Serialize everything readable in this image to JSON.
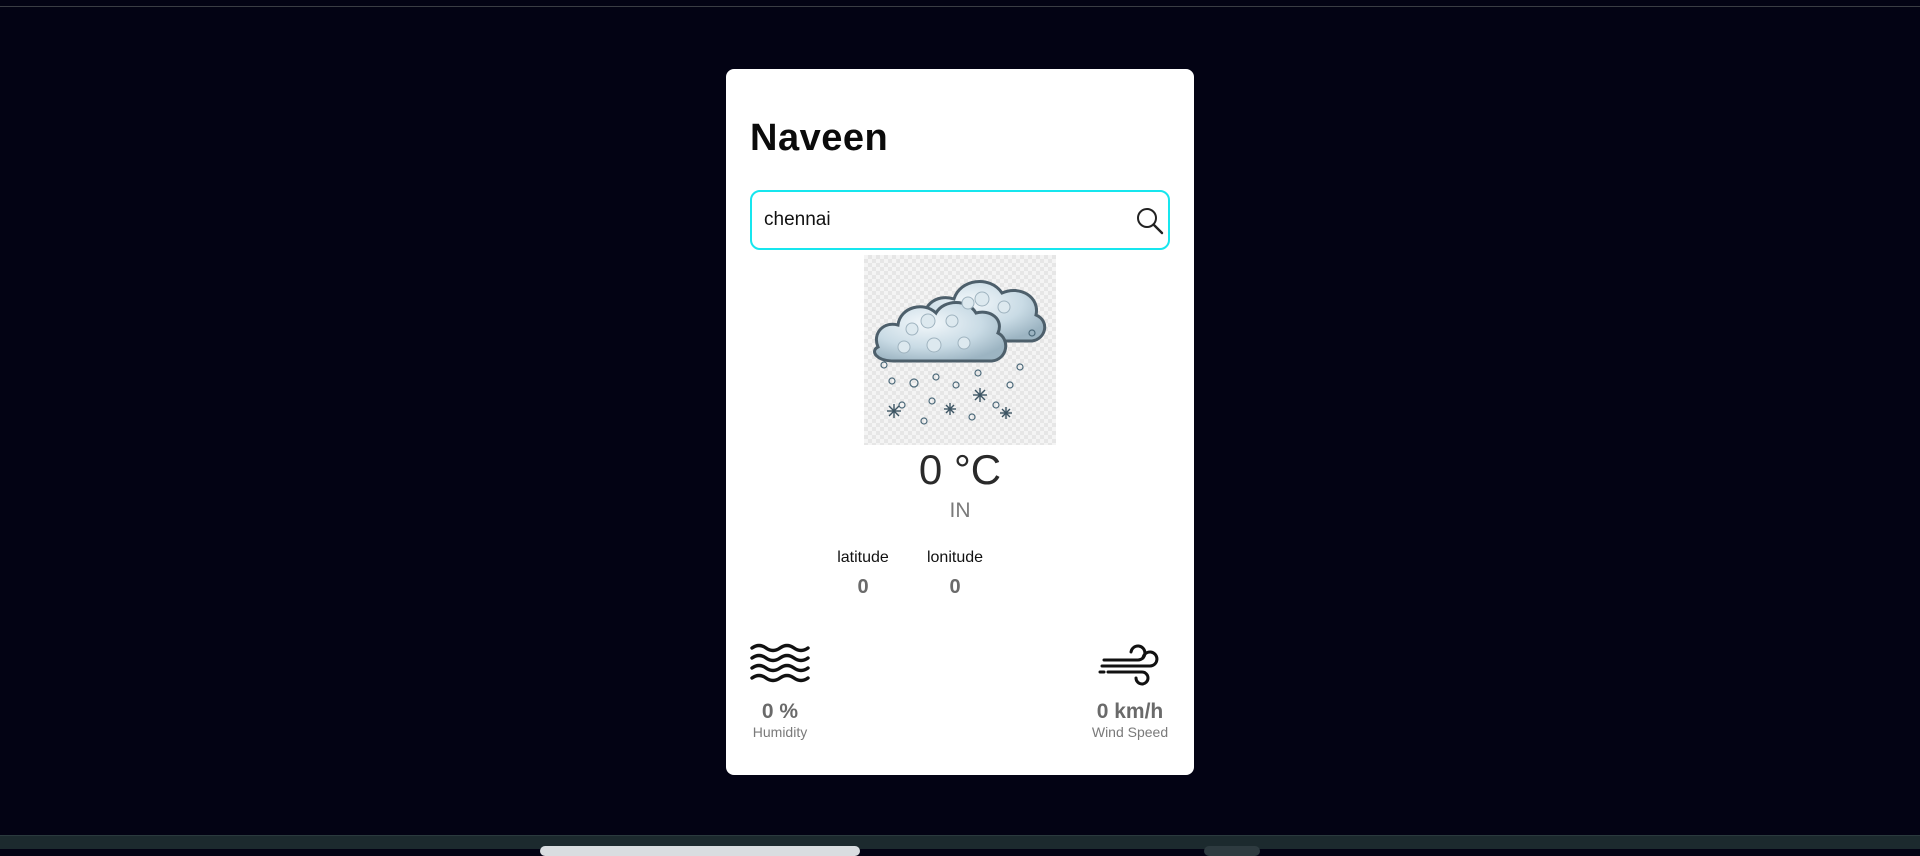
{
  "app": {
    "title": "Naveen"
  },
  "search": {
    "value": "chennai",
    "icon": "search-icon"
  },
  "weather": {
    "icon": "snow-cloud-icon",
    "temperature": "0 °C",
    "country": "IN"
  },
  "coordinates": {
    "latitude_label": "latitude",
    "latitude_value": "0",
    "longitude_label": "lonitude",
    "longitude_value": "0"
  },
  "stats": {
    "humidity_icon": "waves-icon",
    "humidity_value": "0 %",
    "humidity_label": "Humidity",
    "wind_icon": "wind-icon",
    "wind_value": "0 km/h",
    "wind_label": "Wind Speed"
  },
  "colors": {
    "page_background": "#030314",
    "card_background": "#ffffff",
    "search_border": "#17e6ee"
  }
}
